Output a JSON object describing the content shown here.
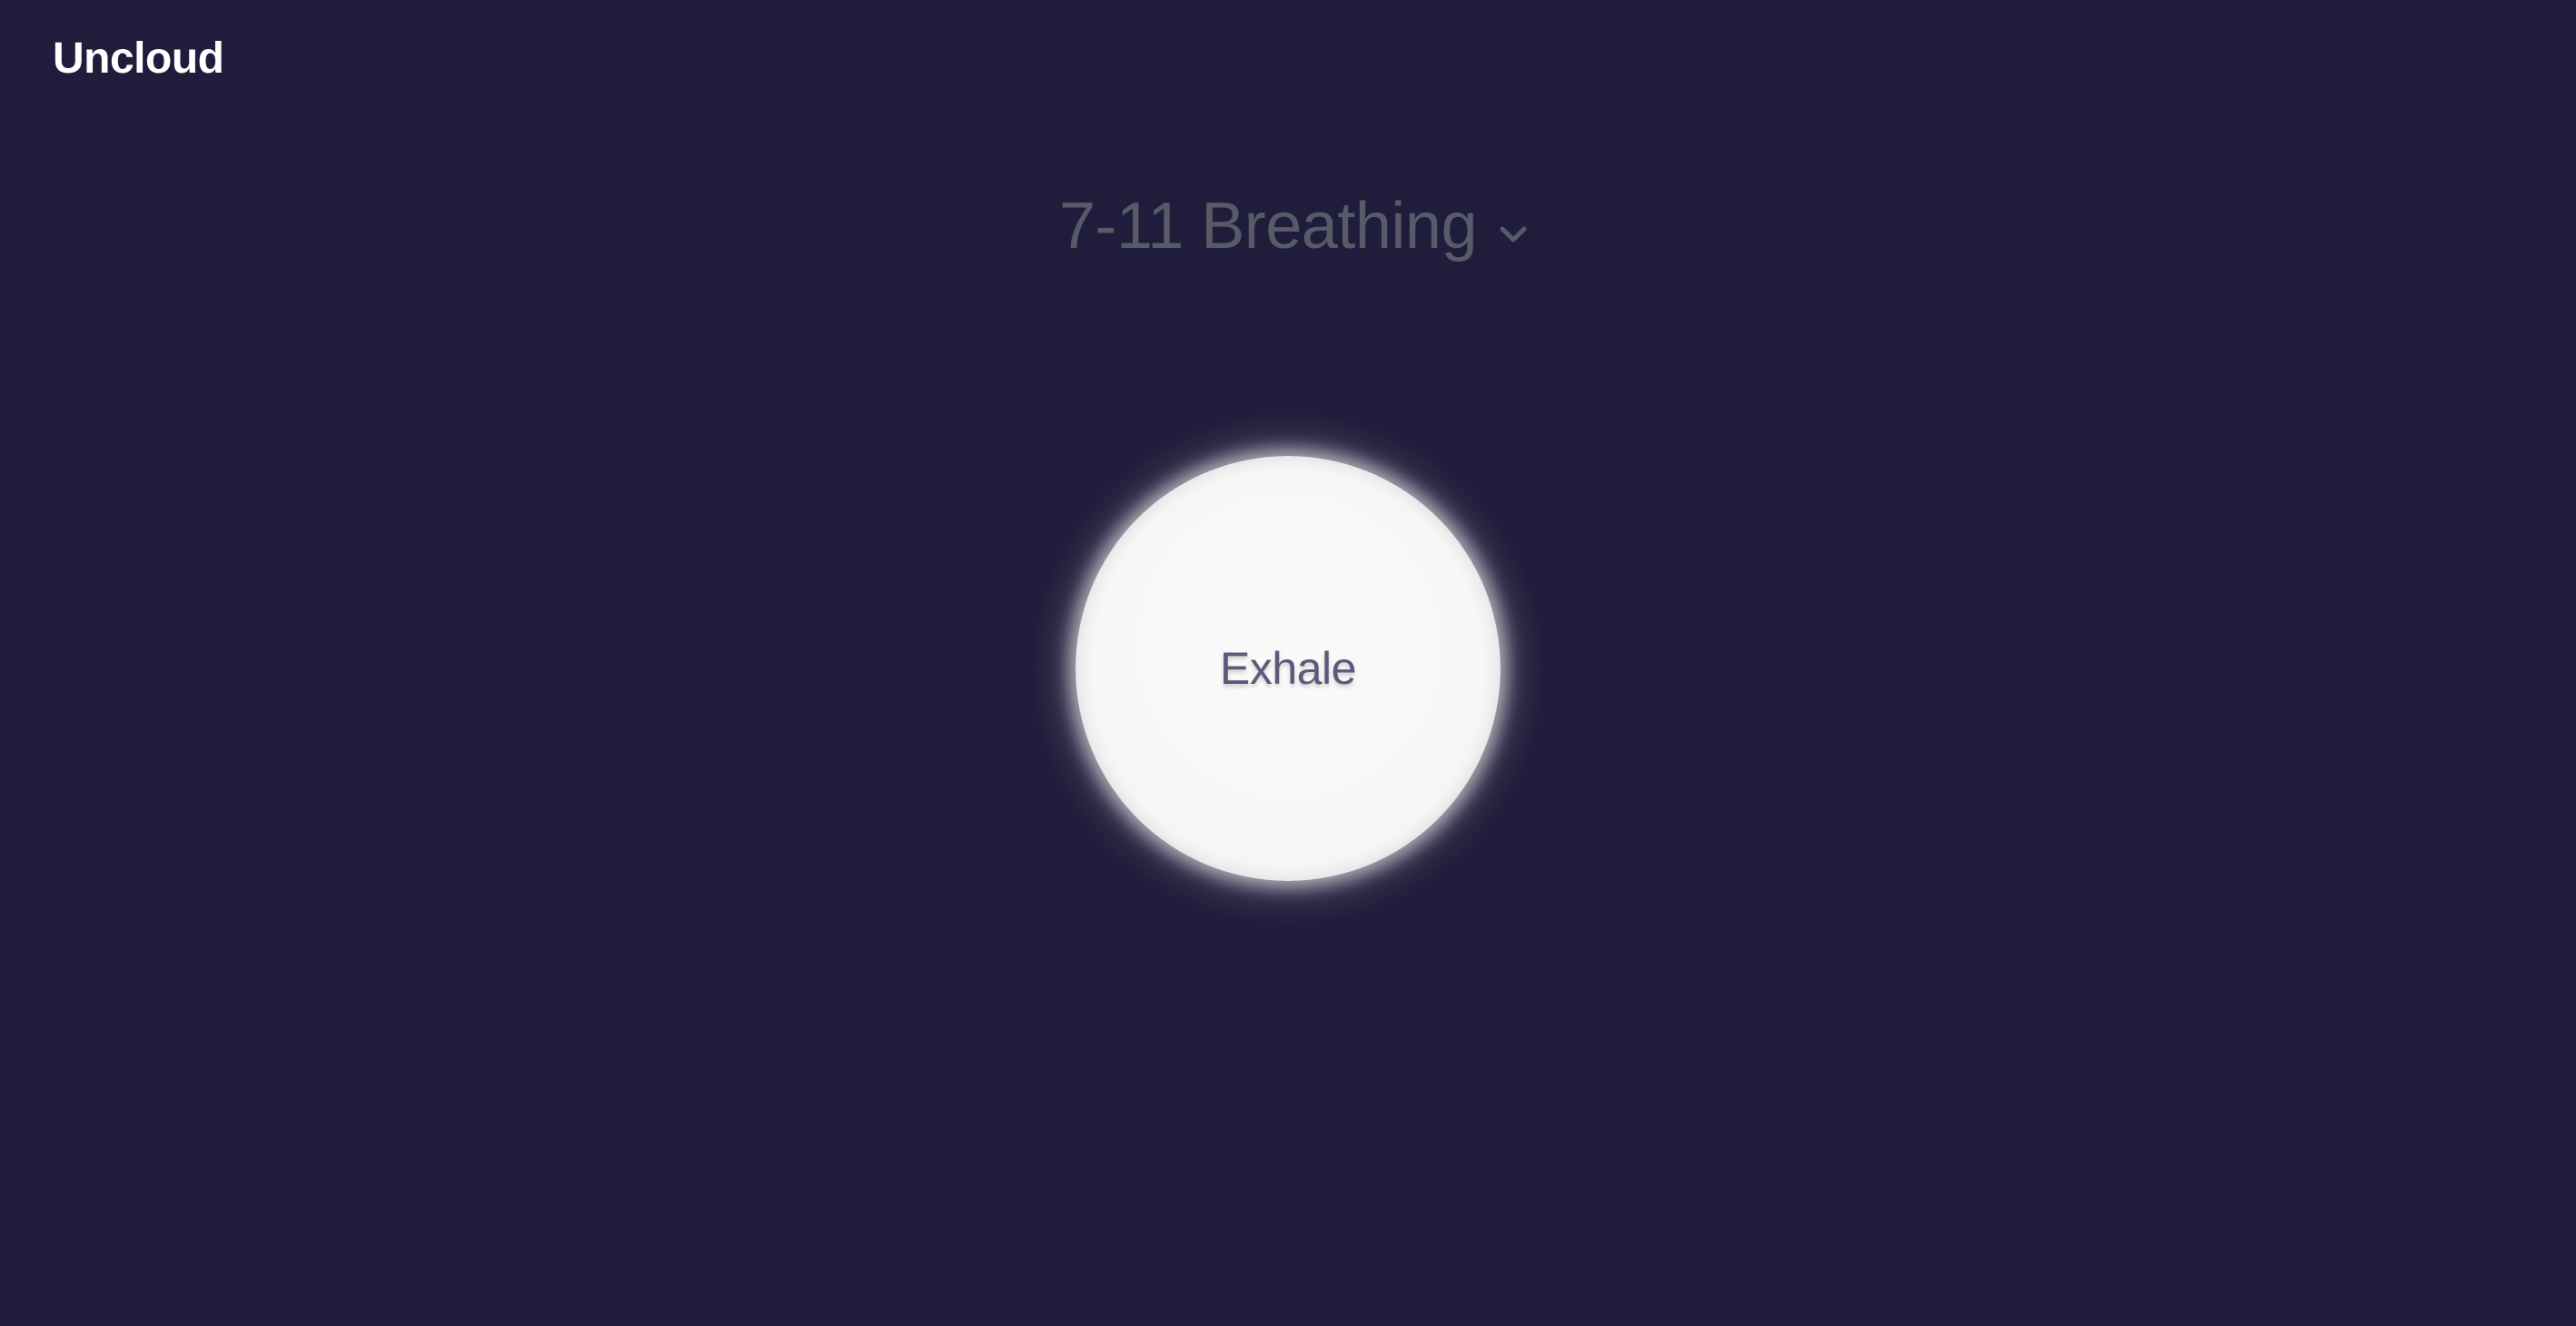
{
  "app": {
    "logo_text": "Uncloud"
  },
  "exercise": {
    "title": "7-11 Breathing",
    "selector_icon": "chevron-down-icon"
  },
  "breath": {
    "phase_label": "Exhale"
  },
  "colors": {
    "background": "#1f1d3b",
    "logo": "#ffffff",
    "title": "#595a68",
    "circle": "#f7f7f7",
    "phase_text": "#5c5a7a"
  }
}
